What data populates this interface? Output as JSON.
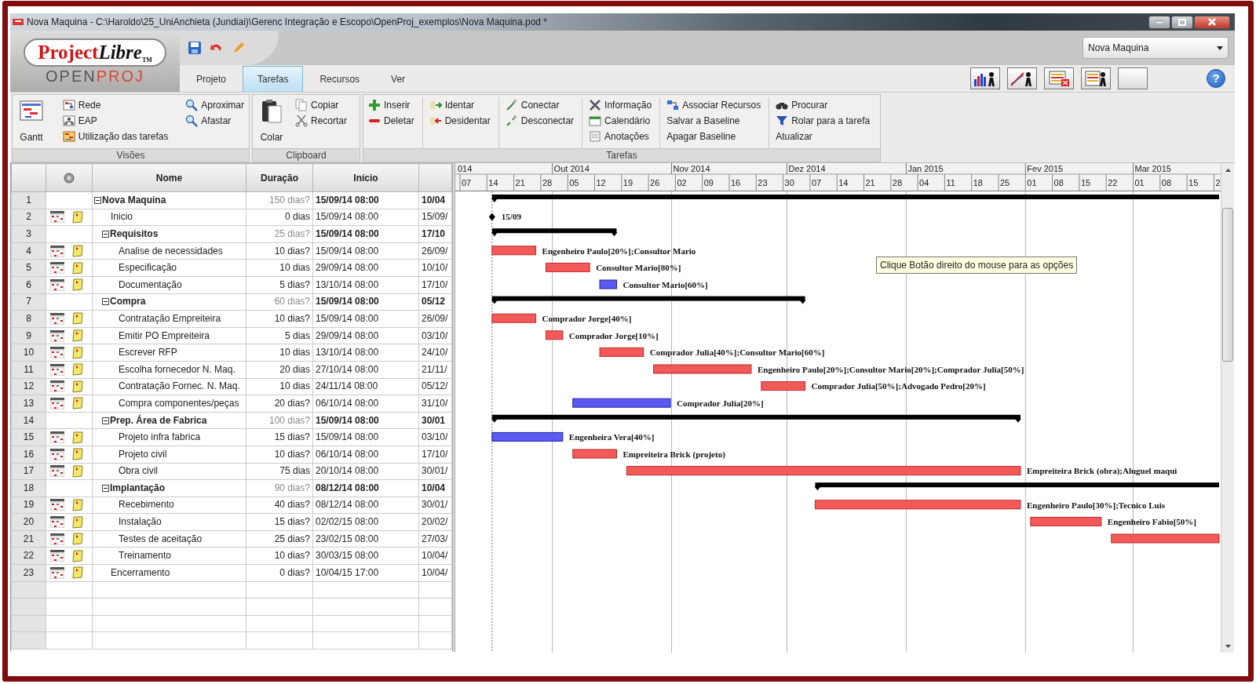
{
  "window": {
    "title": "Nova Maquina - C:\\Haroldo\\25_UniAnchieta (Jundiai)\\Gerenc Integração e Escopo\\OpenProj_exemplos\\Nova Maquina.pod *"
  },
  "logo": {
    "title": [
      {
        "text": "Project",
        "kind": "plain"
      },
      {
        "text": "Libre",
        "kind": "italic"
      },
      {
        "text": "TM",
        "kind": "mark"
      }
    ],
    "subtitle": [
      {
        "text": "OPEN",
        "kind": "plain"
      },
      {
        "text": "PROJ",
        "kind": "accent"
      }
    ]
  },
  "tabs": [
    {
      "label": "Projeto",
      "selected": false
    },
    {
      "label": "Tarefas",
      "selected": true
    },
    {
      "label": "Recursos",
      "selected": false
    },
    {
      "label": "Ver",
      "selected": false
    }
  ],
  "project_select": {
    "value": "Nova Maquina"
  },
  "help": {
    "label": "?"
  },
  "ribbon": {
    "groups": [
      {
        "label": "Visões",
        "divided": false,
        "columns": [
          [
            {
              "label": "Gantt",
              "kind": "large"
            }
          ],
          [
            {
              "label": "Rede",
              "kind": "small"
            },
            {
              "label": "EAP",
              "kind": "small"
            },
            {
              "label": "Utilização das tarefas",
              "kind": "small"
            }
          ],
          [
            {
              "label": "Aproximar",
              "kind": "small"
            },
            {
              "label": "Afastar",
              "kind": "small"
            }
          ]
        ]
      },
      {
        "label": "Clipboard",
        "divided": false,
        "columns": [
          [
            {
              "label": "Colar",
              "kind": "large"
            }
          ],
          [
            {
              "label": "Copiar",
              "kind": "small"
            },
            {
              "label": "Recortar",
              "kind": "small"
            }
          ]
        ]
      },
      {
        "label": "Tarefas",
        "divided": true,
        "columns": [
          [
            {
              "label": "Inserir",
              "kind": "small"
            },
            {
              "label": "Deletar",
              "kind": "small"
            }
          ],
          [
            {
              "label": "Identar",
              "kind": "small"
            },
            {
              "label": "Desidentar",
              "kind": "small"
            }
          ],
          [
            {
              "label": "Conectar",
              "kind": "small"
            },
            {
              "label": "Desconectar",
              "kind": "small"
            }
          ],
          [
            {
              "label": "Informação",
              "kind": "small"
            },
            {
              "label": "Calendário",
              "kind": "small"
            },
            {
              "label": "Anotações",
              "kind": "small"
            }
          ],
          [
            {
              "label": "Associar Recursos",
              "kind": "small"
            },
            {
              "label": "Salvar a Baseline",
              "kind": "small"
            },
            {
              "label": "Apagar Baseline",
              "kind": "small"
            }
          ],
          [
            {
              "label": "Procurar",
              "kind": "small"
            },
            {
              "label": "Rolar para a tarefa",
              "kind": "small"
            },
            {
              "label": "Atualizar",
              "kind": "small"
            }
          ]
        ]
      }
    ]
  },
  "table": {
    "columns": [
      {
        "label": "Nome"
      },
      {
        "label": "Duração"
      },
      {
        "label": "Início"
      }
    ],
    "rows": [
      {
        "num": "1",
        "name": "Nova Maquina",
        "duration": "150 dias?",
        "start": "15/09/14 08:00",
        "finish": "10/04",
        "kind": "summary",
        "expanded": true,
        "children": [
          {
            "num": "2",
            "name": "Inicio",
            "duration": "0 dias",
            "start": "15/09/14 08:00",
            "finish": "15/09/",
            "kind": "milestone",
            "resources": "15/09"
          },
          {
            "num": "3",
            "name": "Requisitos",
            "duration": "25 dias?",
            "start": "15/09/14 08:00",
            "finish": "17/10",
            "kind": "summary",
            "expanded": true,
            "children": [
              {
                "num": "4",
                "name": "Analise de necessidades",
                "duration": "10 dias?",
                "start": "15/09/14 08:00",
                "finish": "26/09/",
                "kind": "task",
                "critical": true,
                "resources": "Engenheiro Paulo[20%];Consultor Mario"
              },
              {
                "num": "5",
                "name": "Especificação",
                "duration": "10 dias",
                "start": "29/09/14 08:00",
                "finish": "10/10/",
                "kind": "task",
                "critical": true,
                "resources": "Consultor Mario[80%]"
              },
              {
                "num": "6",
                "name": "Documentação",
                "duration": "5 dias?",
                "start": "13/10/14 08:00",
                "finish": "17/10/",
                "kind": "task",
                "critical": false,
                "resources": "Consultor Mario[60%]"
              }
            ]
          },
          {
            "num": "7",
            "name": "Compra",
            "duration": "60 dias?",
            "start": "15/09/14 08:00",
            "finish": "05/12",
            "kind": "summary",
            "expanded": true,
            "children": [
              {
                "num": "8",
                "name": "Contratação Empreiteira",
                "duration": "10 dias?",
                "start": "15/09/14 08:00",
                "finish": "26/09/",
                "kind": "task",
                "critical": true,
                "resources": "Comprador Jorge[40%]"
              },
              {
                "num": "9",
                "name": "Emitir PO Empreiteira",
                "duration": "5 dias",
                "start": "29/09/14 08:00",
                "finish": "03/10/",
                "kind": "task",
                "critical": true,
                "resources": "Comprador Jorge[10%]"
              },
              {
                "num": "10",
                "name": "Escrever RFP",
                "duration": "10 dias",
                "start": "13/10/14 08:00",
                "finish": "24/10/",
                "kind": "task",
                "critical": true,
                "resources": "Comprador Julia[40%];Consultor Mario[60%]"
              },
              {
                "num": "11",
                "name": "Escolha fornecedor N. Maq.",
                "duration": "20 dias",
                "start": "27/10/14 08:00",
                "finish": "21/11/",
                "kind": "task",
                "critical": true,
                "resources": "Engenheiro Paulo[20%];Consultor Mario[20%];Comprador Julia[50%]"
              },
              {
                "num": "12",
                "name": "Contratação Fornec. N. Maq.",
                "duration": "10 dias",
                "start": "24/11/14 08:00",
                "finish": "05/12/",
                "kind": "task",
                "critical": true,
                "resources": "Comprador Julia[50%];Advogado Pedro[20%]"
              },
              {
                "num": "13",
                "name": "Compra componentes/peças",
                "duration": "20 dias?",
                "start": "06/10/14 08:00",
                "finish": "31/10/",
                "kind": "task",
                "critical": false,
                "resources": "Comprador Julia[20%]"
              }
            ]
          },
          {
            "num": "14",
            "name": "Prep. Área de Fabrica",
            "duration": "100 dias?",
            "start": "15/09/14 08:00",
            "finish": "30/01",
            "kind": "summary",
            "expanded": true,
            "children": [
              {
                "num": "15",
                "name": "Projeto infra fabrica",
                "duration": "15 dias?",
                "start": "15/09/14 08:00",
                "finish": "03/10/",
                "kind": "task",
                "critical": false,
                "resources": "Engenheira Vera[40%]"
              },
              {
                "num": "16",
                "name": "Projeto civil",
                "duration": "10 dias?",
                "start": "06/10/14 08:00",
                "finish": "17/10/",
                "kind": "task",
                "critical": true,
                "resources": "Empreiteira Brick (projeto)"
              },
              {
                "num": "17",
                "name": "Obra civil",
                "duration": "75 dias",
                "start": "20/10/14 08:00",
                "finish": "30/01/",
                "kind": "task",
                "critical": true,
                "resources": "Empreiteira Brick (obra);Aluguel maqui"
              }
            ]
          },
          {
            "num": "18",
            "name": "Implantação",
            "duration": "90 dias?",
            "start": "08/12/14 08:00",
            "finish": "10/04",
            "kind": "summary",
            "expanded": true,
            "children": [
              {
                "num": "19",
                "name": "Recebimento",
                "duration": "40 dias?",
                "start": "08/12/14 08:00",
                "finish": "30/01/",
                "kind": "task",
                "critical": true,
                "resources": "Engenheiro Paulo[30%];Tecnico Luis"
              },
              {
                "num": "20",
                "name": "Instalação",
                "duration": "15 dias?",
                "start": "02/02/15 08:00",
                "finish": "20/02/",
                "kind": "task",
                "critical": true,
                "resources": "Engenheiro Fabio[50%]"
              },
              {
                "num": "21",
                "name": "Testes de aceitação",
                "duration": "25 dias?",
                "start": "23/02/15 08:00",
                "finish": "27/03/",
                "kind": "task",
                "critical": true
              },
              {
                "num": "22",
                "name": "Treinamento",
                "duration": "10 dias?",
                "start": "30/03/15 08:00",
                "finish": "10/04/",
                "kind": "task"
              }
            ]
          },
          {
            "num": "23",
            "name": "Encerramento",
            "duration": "0 dias?",
            "start": "10/04/15 17:00",
            "finish": "10/04/",
            "kind": "milestone"
          }
        ]
      }
    ]
  },
  "gantt": {
    "months": [
      "014",
      "Out 2014",
      "Nov 2014",
      "Dez 2014",
      "Jan 2015",
      "Fev 2015",
      "Mar 2015"
    ],
    "weeks": [
      "07",
      "14",
      "21",
      "28",
      "05",
      "12",
      "19",
      "26",
      "02",
      "09",
      "16",
      "23",
      "30",
      "07",
      "14",
      "21",
      "28",
      "04",
      "11",
      "18",
      "25",
      "01",
      "08",
      "15",
      "22",
      "01",
      "08",
      "15",
      "2"
    ],
    "tooltip": "Clique Botão direito do mouse para as opções"
  }
}
